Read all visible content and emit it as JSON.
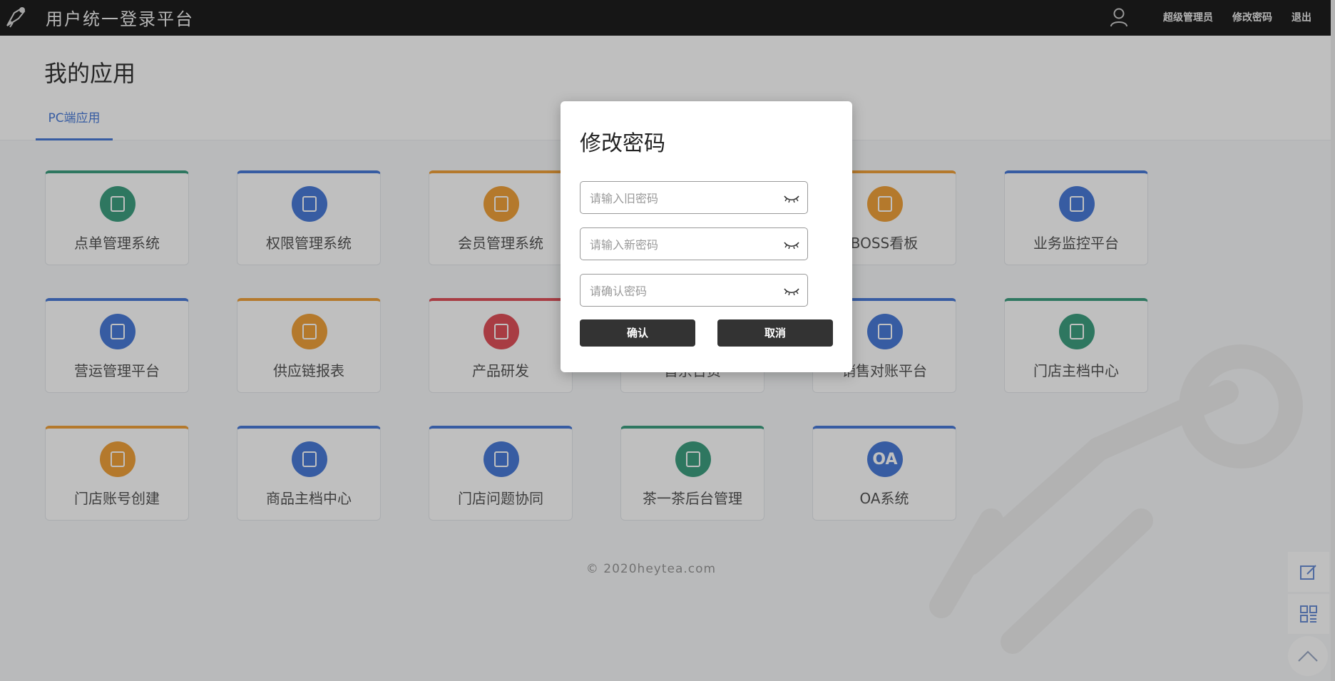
{
  "header": {
    "app_title": "用户统一登录平台",
    "user_role": "超级管理员",
    "change_password": "修改密码",
    "logout": "退出"
  },
  "main": {
    "page_title": "我的应用",
    "tabs": [
      {
        "label": "PC端应用",
        "active": true
      }
    ],
    "apps": [
      {
        "label": "点单管理系统",
        "color": "#3e9f80",
        "icon": "tap-order-icon"
      },
      {
        "label": "权限管理系统",
        "color": "#4a7bd8",
        "icon": "lock-icon"
      },
      {
        "label": "会员管理系统",
        "color": "#f0a23b",
        "icon": "crown-icon"
      },
      {
        "label": "",
        "color": "#f0a23b",
        "icon": "hidden-app-icon"
      },
      {
        "label": "BOSS看板",
        "color": "#f0a23b",
        "icon": "chart-board-icon"
      },
      {
        "label": "业务监控平台",
        "color": "#4a7bd8",
        "icon": "monitor-doc-icon"
      },
      {
        "label": "营运管理平台",
        "color": "#4a7bd8",
        "icon": "operations-doc-icon"
      },
      {
        "label": "供应链报表",
        "color": "#f0a23b",
        "icon": "supply-chain-icon"
      },
      {
        "label": "产品研发",
        "color": "#e0505a",
        "icon": "flask-icon"
      },
      {
        "label": "首京台资",
        "color": "#3e9f80",
        "icon": "hidden-app-icon"
      },
      {
        "label": "销售对账平台",
        "color": "#4a7bd8",
        "icon": "yen-icon"
      },
      {
        "label": "门店主档中心",
        "color": "#3e9f80",
        "icon": "store-file-icon"
      },
      {
        "label": "门店账号创建",
        "color": "#f0a23b",
        "icon": "store-account-icon"
      },
      {
        "label": "商品主档中心",
        "color": "#4a7bd8",
        "icon": "product-file-icon"
      },
      {
        "label": "门店问题协同",
        "color": "#4a7bd8",
        "icon": "store-question-icon"
      },
      {
        "label": "茶一茶后台管理",
        "color": "#3e9f80",
        "icon": "tea-store-icon"
      },
      {
        "label": "OA系统",
        "color": "#4a7bd8",
        "icon": "oa-icon",
        "icon_text": "OA"
      }
    ],
    "footer": "© 2020heytea.com"
  },
  "modal": {
    "title": "修改密码",
    "old_password_placeholder": "请输入旧密码",
    "new_password_placeholder": "请输入新密码",
    "confirm_password_placeholder": "请确认密码",
    "confirm_label": "确认",
    "cancel_label": "取消"
  },
  "colors": {
    "header_bg": "#1e1e1e",
    "accent": "#4a7bd8",
    "green": "#3e9f80",
    "orange": "#f0a23b",
    "red": "#e0505a",
    "button_dark": "#333333"
  }
}
